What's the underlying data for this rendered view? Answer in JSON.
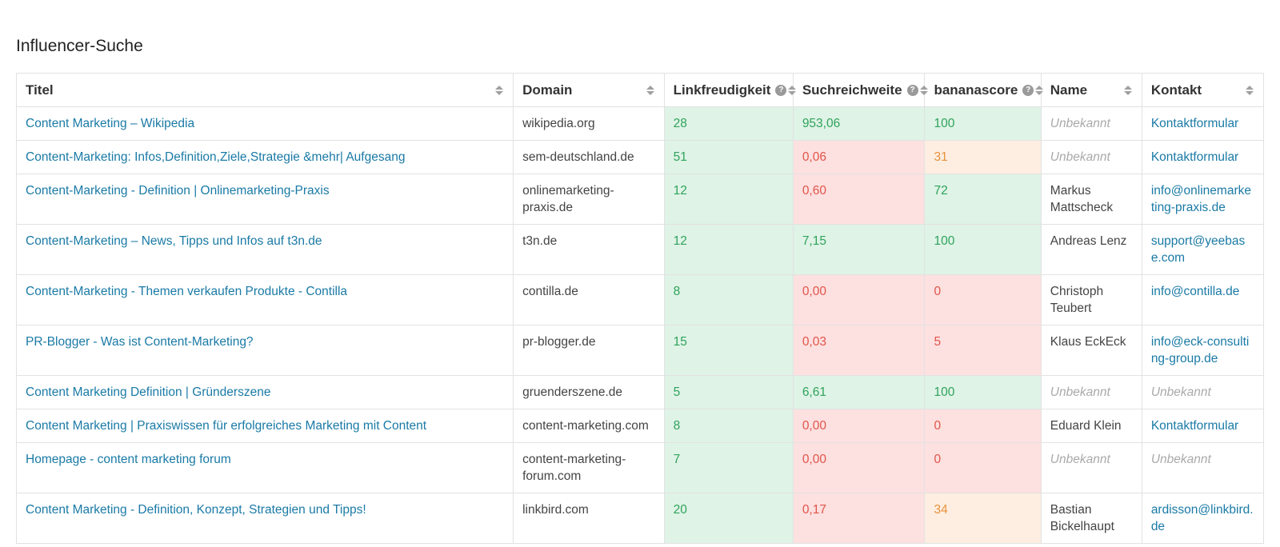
{
  "page": {
    "title": "Influencer-Suche"
  },
  "colors": {
    "link": "#1a7aa6",
    "good_bg": "#dff3e6",
    "good_text": "#2fa35c",
    "bad_bg": "#fde0e0",
    "bad_text": "#e0554a",
    "mid_bg": "#fdeee1",
    "mid_text": "#e8923b"
  },
  "table": {
    "headers": {
      "titel": "Titel",
      "domain": "Domain",
      "linkfreudigkeit": "Linkfreudigkeit",
      "suchreichweite": "Suchreichweite",
      "bananascore": "bananascore",
      "name": "Name",
      "kontakt": "Kontakt"
    },
    "rows": [
      {
        "titel": "Content Marketing – Wikipedia",
        "domain": "wikipedia.org",
        "link": "28",
        "link_status": "good",
        "such": "953,06",
        "such_status": "good",
        "banana": "100",
        "banana_status": "good",
        "name": "Unbekannt",
        "name_unknown": true,
        "kontakt": "Kontaktformular",
        "kontakt_unknown": false
      },
      {
        "titel": "Content-Marketing: Infos,Definition,Ziele,Strategie &mehr| Aufgesang",
        "domain": "sem-deutschland.de",
        "link": "51",
        "link_status": "good",
        "such": "0,06",
        "such_status": "bad",
        "banana": "31",
        "banana_status": "mid",
        "name": "Unbekannt",
        "name_unknown": true,
        "kontakt": "Kontaktformular",
        "kontakt_unknown": false
      },
      {
        "titel": "Content-Marketing - Definition | Onlinemarketing-Praxis",
        "domain": "onlinemarketing-praxis.de",
        "link": "12",
        "link_status": "good",
        "such": "0,60",
        "such_status": "bad",
        "banana": "72",
        "banana_status": "good",
        "name": "Markus Mattscheck",
        "name_unknown": false,
        "kontakt": "info@onlinemarketing-praxis.de",
        "kontakt_unknown": false
      },
      {
        "titel": "Content-Marketing – News, Tipps und Infos auf t3n.de",
        "domain": "t3n.de",
        "link": "12",
        "link_status": "good",
        "such": "7,15",
        "such_status": "good",
        "banana": "100",
        "banana_status": "good",
        "name": "Andreas Lenz",
        "name_unknown": false,
        "kontakt": "support@yeebase.com",
        "kontakt_unknown": false
      },
      {
        "titel": "Content-Marketing - Themen verkaufen Produkte - Contilla",
        "domain": "contilla.de",
        "link": "8",
        "link_status": "good",
        "such": "0,00",
        "such_status": "bad",
        "banana": "0",
        "banana_status": "bad",
        "name": "Christoph Teubert",
        "name_unknown": false,
        "kontakt": "info@contilla.de",
        "kontakt_unknown": false
      },
      {
        "titel": "PR-Blogger - Was ist Content-Marketing?",
        "domain": "pr-blogger.de",
        "link": "15",
        "link_status": "good",
        "such": "0,03",
        "such_status": "bad",
        "banana": "5",
        "banana_status": "bad",
        "name": "Klaus EckEck",
        "name_unknown": false,
        "kontakt": "info@eck-consulting-group.de",
        "kontakt_unknown": false
      },
      {
        "titel": "Content Marketing Definition | Gründerszene",
        "domain": "gruenderszene.de",
        "link": "5",
        "link_status": "good",
        "such": "6,61",
        "such_status": "good",
        "banana": "100",
        "banana_status": "good",
        "name": "Unbekannt",
        "name_unknown": true,
        "kontakt": "Unbekannt",
        "kontakt_unknown": true
      },
      {
        "titel": "Content Marketing | Praxiswissen für erfolgreiches Marketing mit Content",
        "domain": "content-marketing.com",
        "link": "8",
        "link_status": "good",
        "such": "0,00",
        "such_status": "bad",
        "banana": "0",
        "banana_status": "bad",
        "name": "Eduard Klein",
        "name_unknown": false,
        "kontakt": "Kontaktformular",
        "kontakt_unknown": false
      },
      {
        "titel": "Homepage - content marketing forum",
        "domain": "content-marketing-forum.com",
        "link": "7",
        "link_status": "good",
        "such": "0,00",
        "such_status": "bad",
        "banana": "0",
        "banana_status": "bad",
        "name": "Unbekannt",
        "name_unknown": true,
        "kontakt": "Unbekannt",
        "kontakt_unknown": true
      },
      {
        "titel": "Content Marketing - Definition, Konzept, Strategien und Tipps!",
        "domain": "linkbird.com",
        "link": "20",
        "link_status": "good",
        "such": "0,17",
        "such_status": "bad",
        "banana": "34",
        "banana_status": "mid",
        "name": "Bastian Bickelhaupt",
        "name_unknown": false,
        "kontakt": "ardisson@linkbird.de",
        "kontakt_unknown": false
      }
    ]
  }
}
